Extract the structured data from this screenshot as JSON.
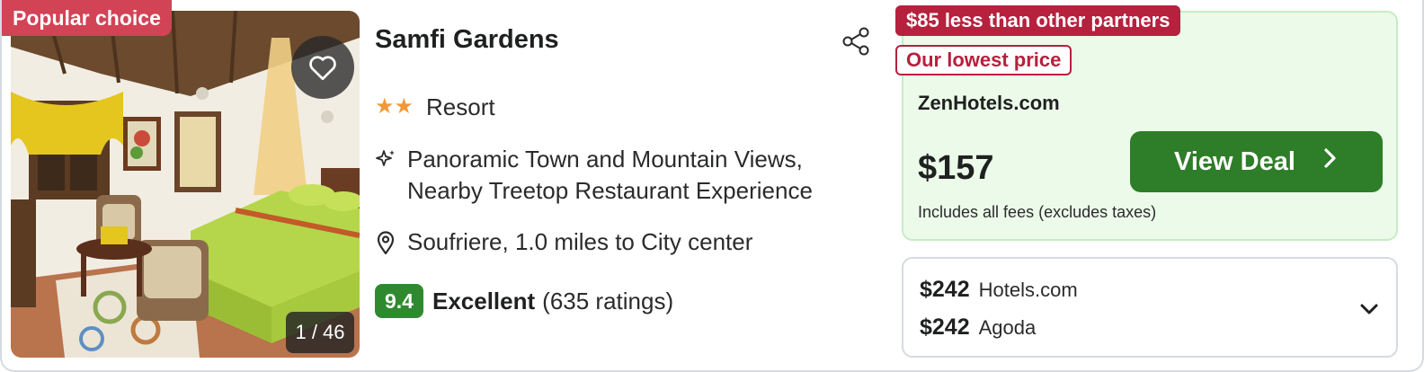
{
  "photo": {
    "badge": "Popular choice",
    "counter": "1 / 46"
  },
  "hotel": {
    "name": "Samfi Gardens",
    "stars": 2,
    "type": "Resort",
    "features_line1": "Panoramic Town and Mountain Views,",
    "features_line2": "Nearby Treetop Restaurant Experience",
    "location": "Soufriere, 1.0 miles to City center",
    "score": "9.4",
    "rating_word": "Excellent",
    "rating_count": "(635 ratings)"
  },
  "deal": {
    "savings_tag": "$85 less than other partners",
    "lowest_tag": "Our lowest price",
    "provider": "ZenHotels.com",
    "price": "$157",
    "button_label": "View Deal",
    "fees_note": "Includes all fees (excludes taxes)"
  },
  "other_offers": [
    {
      "price": "$242",
      "provider": "Hotels.com"
    },
    {
      "price": "$242",
      "provider": "Agoda"
    }
  ],
  "colors": {
    "popular_badge": "#d24356",
    "savings_tag": "#b6213d",
    "deal_button": "#2e7d28",
    "score_badge": "#2f8a2f",
    "stars": "#f1993a"
  },
  "icons": [
    "heart-icon",
    "share-icon",
    "sparkle-icon",
    "map-pin-icon",
    "chevron-right-icon",
    "chevron-down-icon"
  ]
}
